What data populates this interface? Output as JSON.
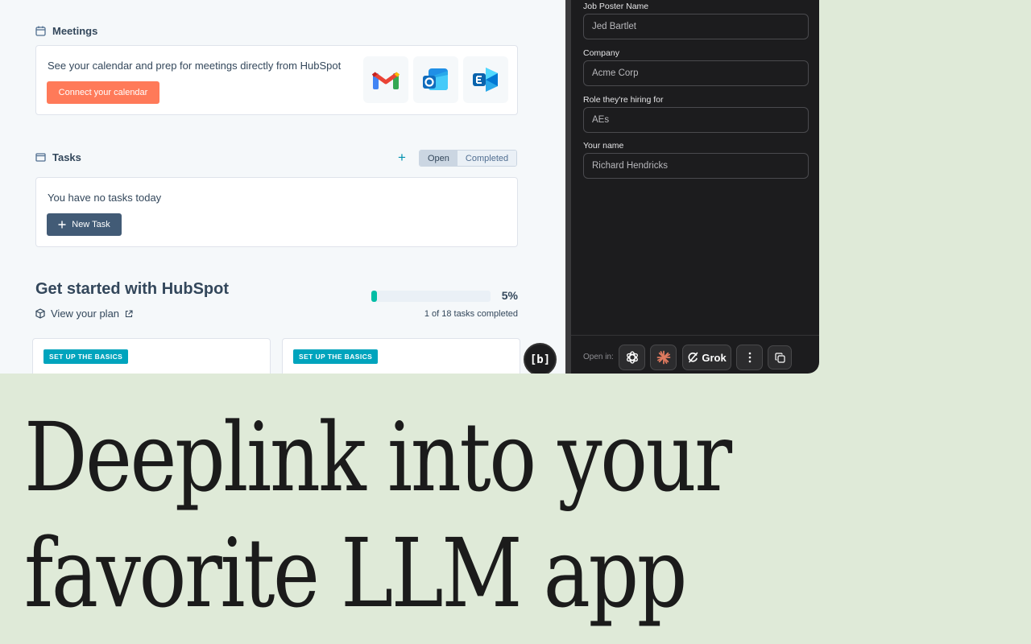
{
  "meetings": {
    "title": "Meetings",
    "description": "See your calendar and prep for meetings directly from HubSpot",
    "connect_button": "Connect your calendar",
    "apps": [
      "gmail-icon",
      "outlook-icon",
      "exchange-icon"
    ]
  },
  "tasks": {
    "title": "Tasks",
    "toggle": [
      "Open",
      "Completed"
    ],
    "active_toggle": "Open",
    "empty_text": "You have no tasks today",
    "new_task_button": "New Task"
  },
  "get_started": {
    "title": "Get started with HubSpot",
    "plan_link": "View your plan",
    "progress_percent_label": "5%",
    "progress_fraction": 0.05,
    "tasks_completed": "1 of 18 tasks completed",
    "cards": [
      {
        "badge": "SET UP THE BASICS"
      },
      {
        "badge": "SET UP THE BASICS"
      }
    ]
  },
  "extension_button": "[b]",
  "side_panel": {
    "fields": [
      {
        "label": "Job Poster Name",
        "value": "Jed Bartlet"
      },
      {
        "label": "Company",
        "value": "Acme Corp"
      },
      {
        "label": "Role they're hiring for",
        "value": "AEs"
      },
      {
        "label": "Your name",
        "value": "Richard Hendricks"
      }
    ],
    "footer": {
      "open_in_label": "Open in:",
      "grok_label": "Grok",
      "buttons": [
        "chatgpt-icon",
        "claude-icon",
        "grok-icon",
        "more-icon",
        "copy-icon"
      ]
    }
  },
  "headline": {
    "line1": "Deeplink into your",
    "line2": "favorite LLM app"
  },
  "colors": {
    "background": "#dfead8",
    "hubspot_orange": "#ff7a59",
    "hubspot_teal": "#00a4bd",
    "dark_panel": "#1c1c1e"
  }
}
